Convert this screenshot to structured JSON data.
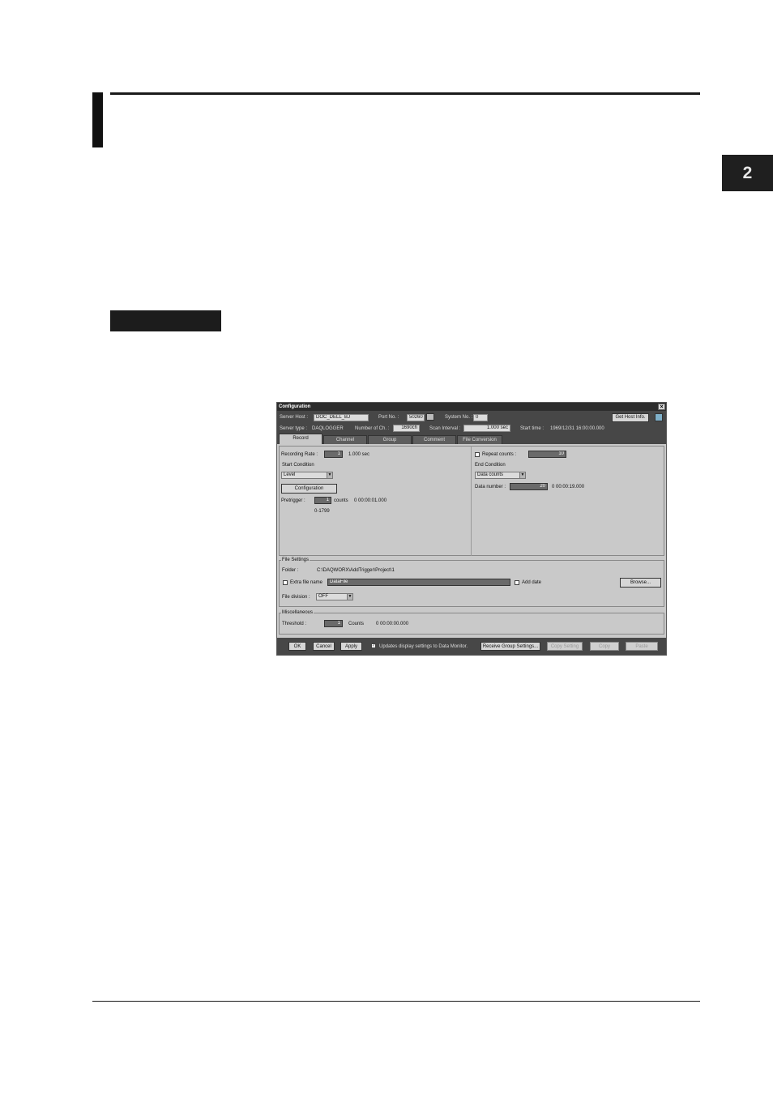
{
  "chapter_tab": "2",
  "dialog": {
    "title": "Configuration",
    "close_glyph": "×",
    "header": {
      "server_host_label": "Server Host :",
      "server_host_value": "DOC_DELL_BJ",
      "port_label": "Port No. :",
      "port_value": "50260",
      "system_label": "System No. :",
      "system_value": "0",
      "get_host_info": "Get Host Info.",
      "server_type_label": "Server type :",
      "server_type_value": "DAQLOGGER",
      "num_ch_label": "Number of Ch. :",
      "num_ch_value": "1690ch",
      "scan_label": "Scan Interval :",
      "scan_value": "1.000 sec",
      "start_time_label": "Start time :",
      "start_time_value": "1969/12/31 16:00:00.000"
    },
    "tabs": [
      "Record",
      "Channel",
      "Group",
      "Comment",
      "File Conversion"
    ],
    "record": {
      "recording_rate_label": "Recording Rate :",
      "recording_rate_value": "1",
      "recording_rate_unit": "1.000 sec",
      "start_condition_title": "Start Condition",
      "start_condition_value": "Level",
      "configuration_button": "Configuration",
      "pretrigger_label": "Pretrigger :",
      "pretrigger_value": "1",
      "pretrigger_unit": "counts",
      "pretrigger_time": "0 00:00:01.000",
      "pretrigger_range": "0-1799",
      "repeat_label": "Repeat counts :",
      "repeat_value": "10",
      "end_condition_title": "End Condition",
      "end_condition_value": "Data counts",
      "data_number_label": "Data number :",
      "data_number_value": "20",
      "data_number_time": "0 00:00:19.000"
    },
    "file_settings": {
      "title": "File Settings",
      "folder_label": "Folder :",
      "folder_value": "C:\\DAQWORX\\AddTrigger\\Project\\1",
      "extra_label": "Extra file name",
      "extra_value": "DataFile",
      "add_date_label": "Add date",
      "browse": "Browse...",
      "division_label": "File division :",
      "division_value": "OFF"
    },
    "misc": {
      "title": "Miscellaneous",
      "threshold_label": "Threshold :",
      "threshold_value": "1",
      "threshold_unit": "Counts",
      "threshold_time": "0 00:00:00.000"
    },
    "footer": {
      "ok": "OK",
      "cancel": "Cancel",
      "apply": "Apply",
      "update_label": "Updates display settings to Data Monitor.",
      "receive": "Receive Group Settings...",
      "copy_setting": "Copy Setting",
      "copy": "Copy",
      "paste": "Paste"
    }
  }
}
